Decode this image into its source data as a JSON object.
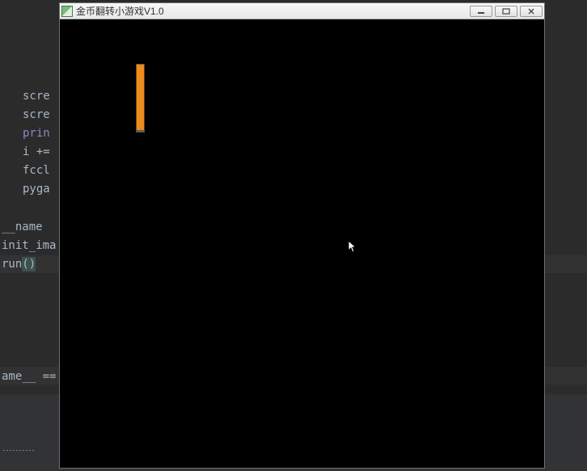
{
  "editor": {
    "lines": {
      "scre1": "scre",
      "scre2": "scre",
      "print": "prin",
      "iplus": "i +=",
      "fccl": "fccl",
      "pyga": "pyga"
    },
    "lower": {
      "name": "__name",
      "init": "init_ima",
      "run": "run",
      "paren": "()"
    },
    "bottom": {
      "ame": "ame__ == '"
    }
  },
  "window": {
    "title": "金币翻转小游戏V1.0",
    "controls": {
      "minimize": "minimize",
      "maximize": "maximize",
      "close": "close"
    }
  },
  "game": {
    "coin_color": "#ed8b1c"
  }
}
